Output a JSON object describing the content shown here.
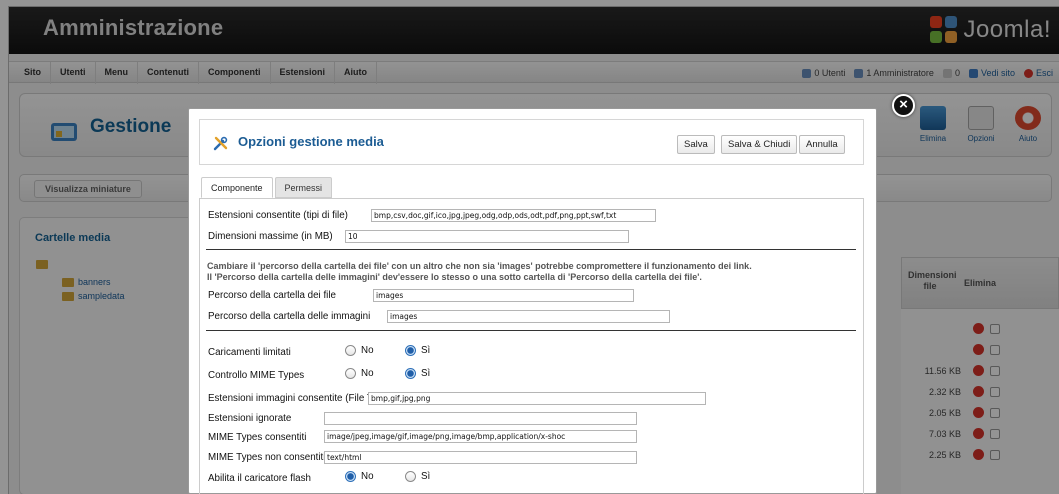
{
  "header": {
    "title": "Amministrazione",
    "logo_text": "Joomla!"
  },
  "menu": {
    "items": [
      "Sito",
      "Utenti",
      "Menu",
      "Contenuti",
      "Componenti",
      "Estensioni",
      "Aiuto"
    ],
    "status": {
      "users": "0 Utenti",
      "admins": "1 Amministratore",
      "messages": "0",
      "view_site": "Vedi sito",
      "logout": "Esci"
    }
  },
  "toolbar": {
    "page_title": "Gestione",
    "buttons": {
      "delete": "Elimina",
      "options": "Opzioni",
      "help": "Aiuto"
    }
  },
  "subbar": {
    "thumbs_button": "Visualizza miniature"
  },
  "folders": {
    "title": "Cartelle media",
    "items": [
      "banners",
      "sampledata"
    ]
  },
  "table": {
    "col_size": "Dimensioni file",
    "col_delete": "Elimina",
    "sizes": [
      "",
      "",
      "11.56 KB",
      "2.32 KB",
      "2.05 KB",
      "7.03 KB",
      "2.25 KB"
    ]
  },
  "modal": {
    "title": "Opzioni gestione media",
    "buttons": {
      "save": "Salva",
      "save_close": "Salva & Chiudi",
      "cancel": "Annulla"
    },
    "tabs": {
      "component": "Componente",
      "permissions": "Permessi"
    },
    "fields": {
      "ext_label": "Estensioni consentite (tipi di file)",
      "ext_value": "bmp,csv,doc,gif,ico,jpg,jpeg,odg,odp,ods,odt,pdf,png,ppt,swf,txt",
      "maxsize_label": "Dimensioni massime (in MB)",
      "maxsize_value": "10",
      "warning_line1": "Cambiare il 'percorso della cartella dei file' con un altro che non sia 'images' potrebbe compromettere il funzionamento dei link.",
      "warning_line2": "Il 'Percorso della cartella delle immagini' dev'essere lo stesso o una sotto cartella di 'Percorso della cartella dei file'.",
      "filepath_label": "Percorso della cartella dei file",
      "filepath_value": "images",
      "imagepath_label": "Percorso della cartella delle immagini",
      "imagepath_value": "images",
      "restrict_label": "Caricamenti limitati",
      "mime_check_label": "Controllo MIME Types",
      "image_ext_label": "Estensioni immagini consentite (File Types)",
      "image_ext_value": "bmp,gif,jpg,png",
      "ignore_label": "Estensioni ignorate",
      "ignore_value": "",
      "mime_allowed_label": "MIME Types consentiti",
      "mime_allowed_value": "image/jpeg,image/gif,image/png,image/bmp,application/x-shoc",
      "mime_denied_label": "MIME Types non consentiti",
      "mime_denied_value": "text/html",
      "flash_label": "Abilita il caricatore flash",
      "no": "No",
      "yes": "Sì"
    }
  }
}
